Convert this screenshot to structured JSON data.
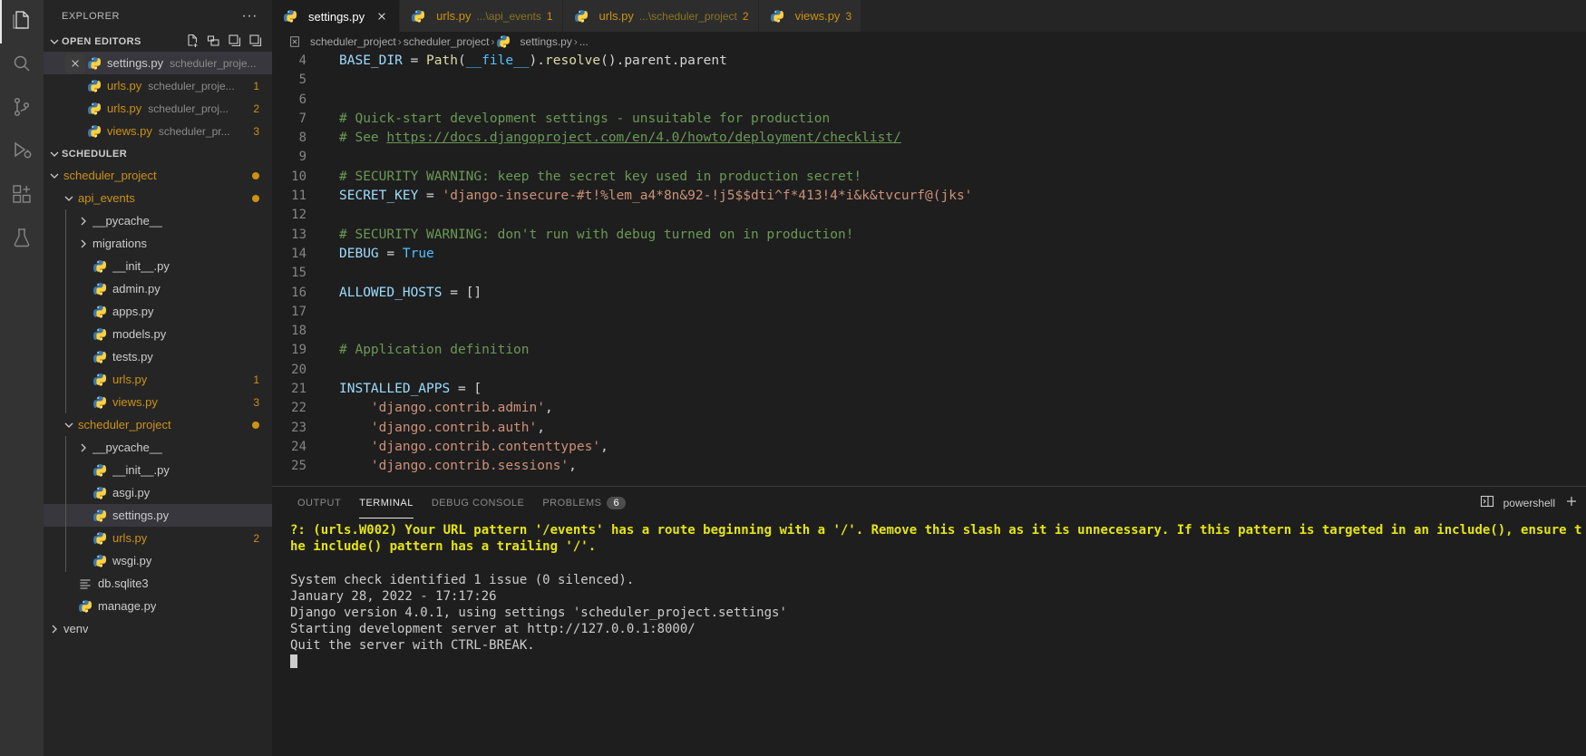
{
  "activity_bar": {
    "items": [
      {
        "name": "explorer",
        "icon": "files-icon",
        "active": true
      },
      {
        "name": "search",
        "icon": "search-icon",
        "active": false
      },
      {
        "name": "source-control",
        "icon": "source-control-icon",
        "active": false
      },
      {
        "name": "run-and-debug",
        "icon": "run-debug-icon",
        "active": false
      },
      {
        "name": "extensions",
        "icon": "extensions-icon",
        "active": false
      },
      {
        "name": "testing",
        "icon": "beaker-icon",
        "active": false
      }
    ]
  },
  "sidebar": {
    "title": "EXPLORER",
    "more_actions": "···",
    "open_editors": {
      "label": "OPEN EDITORS",
      "actions": [
        "new-file-icon",
        "new-folder-icon",
        "save-all-icon",
        "collapse-all-icon"
      ],
      "items": [
        {
          "name": "settings.py",
          "desc": "scheduler_proje...",
          "badge": "",
          "selected": true,
          "dirty": false
        },
        {
          "name": "urls.py",
          "desc": "scheduler_proje...",
          "badge": "1",
          "selected": false
        },
        {
          "name": "urls.py",
          "desc": "scheduler_proj...",
          "badge": "2",
          "selected": false
        },
        {
          "name": "views.py",
          "desc": "scheduler_pr...",
          "badge": "3",
          "selected": false
        }
      ]
    },
    "workspace": {
      "label": "SCHEDULER",
      "tree": [
        {
          "label": "scheduler_project",
          "type": "folder",
          "depth": 1,
          "expanded": true,
          "color": "yellow",
          "dot": true
        },
        {
          "label": "api_events",
          "type": "folder",
          "depth": 2,
          "expanded": true,
          "color": "yellow",
          "dot": true
        },
        {
          "label": "__pycache__",
          "type": "folder",
          "depth": 3,
          "expanded": false,
          "color": "plain"
        },
        {
          "label": "migrations",
          "type": "folder",
          "depth": 3,
          "expanded": false,
          "color": "plain"
        },
        {
          "label": "__init__.py",
          "type": "file",
          "depth": 3,
          "color": "plain"
        },
        {
          "label": "admin.py",
          "type": "file",
          "depth": 3,
          "color": "plain"
        },
        {
          "label": "apps.py",
          "type": "file",
          "depth": 3,
          "color": "plain"
        },
        {
          "label": "models.py",
          "type": "file",
          "depth": 3,
          "color": "plain"
        },
        {
          "label": "tests.py",
          "type": "file",
          "depth": 3,
          "color": "plain"
        },
        {
          "label": "urls.py",
          "type": "file",
          "depth": 3,
          "color": "yellow",
          "badge": "1"
        },
        {
          "label": "views.py",
          "type": "file",
          "depth": 3,
          "color": "yellow",
          "badge": "3"
        },
        {
          "label": "scheduler_project",
          "type": "folder",
          "depth": 2,
          "expanded": true,
          "color": "yellow",
          "dot": true
        },
        {
          "label": "__pycache__",
          "type": "folder",
          "depth": 3,
          "expanded": false,
          "color": "plain"
        },
        {
          "label": "__init__.py",
          "type": "file",
          "depth": 3,
          "color": "plain"
        },
        {
          "label": "asgi.py",
          "type": "file",
          "depth": 3,
          "color": "plain"
        },
        {
          "label": "settings.py",
          "type": "file",
          "depth": 3,
          "color": "plain",
          "selected": true
        },
        {
          "label": "urls.py",
          "type": "file",
          "depth": 3,
          "color": "yellow",
          "badge": "2"
        },
        {
          "label": "wsgi.py",
          "type": "file",
          "depth": 3,
          "color": "plain"
        },
        {
          "label": "db.sqlite3",
          "type": "db",
          "depth": 2,
          "color": "plain"
        },
        {
          "label": "manage.py",
          "type": "file",
          "depth": 2,
          "color": "plain"
        },
        {
          "label": "venv",
          "type": "folder",
          "depth": 1,
          "expanded": false,
          "color": "plain"
        }
      ]
    }
  },
  "tabs": [
    {
      "name": "settings.py",
      "desc": "",
      "num": "",
      "active": true,
      "closable": true
    },
    {
      "name": "urls.py",
      "desc": "...\\api_events",
      "num": "1",
      "active": false
    },
    {
      "name": "urls.py",
      "desc": "...\\scheduler_project",
      "num": "2",
      "active": false
    },
    {
      "name": "views.py",
      "desc": "",
      "num": "3",
      "active": false
    }
  ],
  "breadcrumbs": {
    "crumbs": [
      "scheduler_project",
      "scheduler_project",
      "settings.py",
      "..."
    ],
    "separator": "›"
  },
  "editor": {
    "lines": [
      {
        "n": "4",
        "tokens": [
          {
            "t": "BASE_DIR",
            "c": "c-var"
          },
          {
            "t": " = ",
            "c": "c-plain"
          },
          {
            "t": "Path",
            "c": "c-fn"
          },
          {
            "t": "(",
            "c": "c-plain"
          },
          {
            "t": "__file__",
            "c": "c-const"
          },
          {
            "t": ").",
            "c": "c-plain"
          },
          {
            "t": "resolve",
            "c": "c-fn"
          },
          {
            "t": "().parent.parent",
            "c": "c-plain"
          }
        ]
      },
      {
        "n": "5",
        "tokens": []
      },
      {
        "n": "6",
        "tokens": []
      },
      {
        "n": "7",
        "tokens": [
          {
            "t": "# Quick-start development settings - unsuitable for production",
            "c": "c-comment"
          }
        ]
      },
      {
        "n": "8",
        "tokens": [
          {
            "t": "# See ",
            "c": "c-comment"
          },
          {
            "t": "https://docs.djangoproject.com/en/4.0/howto/deployment/checklist/",
            "c": "c-link"
          }
        ]
      },
      {
        "n": "9",
        "tokens": []
      },
      {
        "n": "10",
        "tokens": [
          {
            "t": "# SECURITY WARNING: keep the secret key used in production secret!",
            "c": "c-comment"
          }
        ]
      },
      {
        "n": "11",
        "tokens": [
          {
            "t": "SECRET_KEY",
            "c": "c-var"
          },
          {
            "t": " = ",
            "c": "c-plain"
          },
          {
            "t": "'django-insecure-#t!%lem_a4*8n&92-!j5$$dti^f*413!4*i&k&tvcurf@(jks'",
            "c": "c-string"
          }
        ]
      },
      {
        "n": "12",
        "tokens": []
      },
      {
        "n": "13",
        "tokens": [
          {
            "t": "# SECURITY WARNING: don't run with debug turned on in production!",
            "c": "c-comment"
          }
        ]
      },
      {
        "n": "14",
        "tokens": [
          {
            "t": "DEBUG",
            "c": "c-var"
          },
          {
            "t": " = ",
            "c": "c-plain"
          },
          {
            "t": "True",
            "c": "c-const"
          }
        ]
      },
      {
        "n": "15",
        "tokens": []
      },
      {
        "n": "16",
        "tokens": [
          {
            "t": "ALLOWED_HOSTS",
            "c": "c-var"
          },
          {
            "t": " = []",
            "c": "c-plain"
          }
        ]
      },
      {
        "n": "17",
        "tokens": []
      },
      {
        "n": "18",
        "tokens": []
      },
      {
        "n": "19",
        "tokens": [
          {
            "t": "# Application definition",
            "c": "c-comment"
          }
        ]
      },
      {
        "n": "20",
        "tokens": []
      },
      {
        "n": "21",
        "tokens": [
          {
            "t": "INSTALLED_APPS",
            "c": "c-var"
          },
          {
            "t": " = [",
            "c": "c-plain"
          }
        ]
      },
      {
        "n": "22",
        "tokens": [
          {
            "t": "    ",
            "c": "c-plain"
          },
          {
            "t": "'django.contrib.admin'",
            "c": "c-string"
          },
          {
            "t": ",",
            "c": "c-plain"
          }
        ]
      },
      {
        "n": "23",
        "tokens": [
          {
            "t": "    ",
            "c": "c-plain"
          },
          {
            "t": "'django.contrib.auth'",
            "c": "c-string"
          },
          {
            "t": ",",
            "c": "c-plain"
          }
        ]
      },
      {
        "n": "24",
        "tokens": [
          {
            "t": "    ",
            "c": "c-plain"
          },
          {
            "t": "'django.contrib.contenttypes'",
            "c": "c-string"
          },
          {
            "t": ",",
            "c": "c-plain"
          }
        ]
      },
      {
        "n": "25",
        "tokens": [
          {
            "t": "    ",
            "c": "c-plain"
          },
          {
            "t": "'django.contrib.sessions'",
            "c": "c-string"
          },
          {
            "t": ",",
            "c": "c-plain"
          }
        ]
      }
    ]
  },
  "panel": {
    "tabs": [
      {
        "label": "OUTPUT",
        "active": false,
        "badge": ""
      },
      {
        "label": "TERMINAL",
        "active": true,
        "badge": ""
      },
      {
        "label": "DEBUG CONSOLE",
        "active": false,
        "badge": ""
      },
      {
        "label": "PROBLEMS",
        "active": false,
        "badge": "6"
      }
    ],
    "shell_label": "powershell",
    "terminal_lines": [
      {
        "t": "?: (urls.W002) Your URL pattern '/events' has a route beginning with a '/'. Remove this slash as it is unnecessary. If this pattern is targeted in an include(), ensure t",
        "warn": true
      },
      {
        "t": "he include() pattern has a trailing '/'.",
        "warn": true
      },
      {
        "t": "",
        "warn": false
      },
      {
        "t": "System check identified 1 issue (0 silenced).",
        "warn": false
      },
      {
        "t": "January 28, 2022 - 17:17:26",
        "warn": false
      },
      {
        "t": "Django version 4.0.1, using settings 'scheduler_project.settings'",
        "warn": false
      },
      {
        "t": "Starting development server at http://127.0.0.1:8000/",
        "warn": false
      },
      {
        "t": "Quit the server with CTRL-BREAK.",
        "warn": false
      }
    ]
  },
  "colors": {
    "accent_yellow": "#cc9213",
    "terminal_warning": "#e5e510",
    "selection": "#37373d",
    "editor_bg": "#1e1e1e",
    "sidebar_bg": "#252526",
    "activitybar_bg": "#333333"
  }
}
